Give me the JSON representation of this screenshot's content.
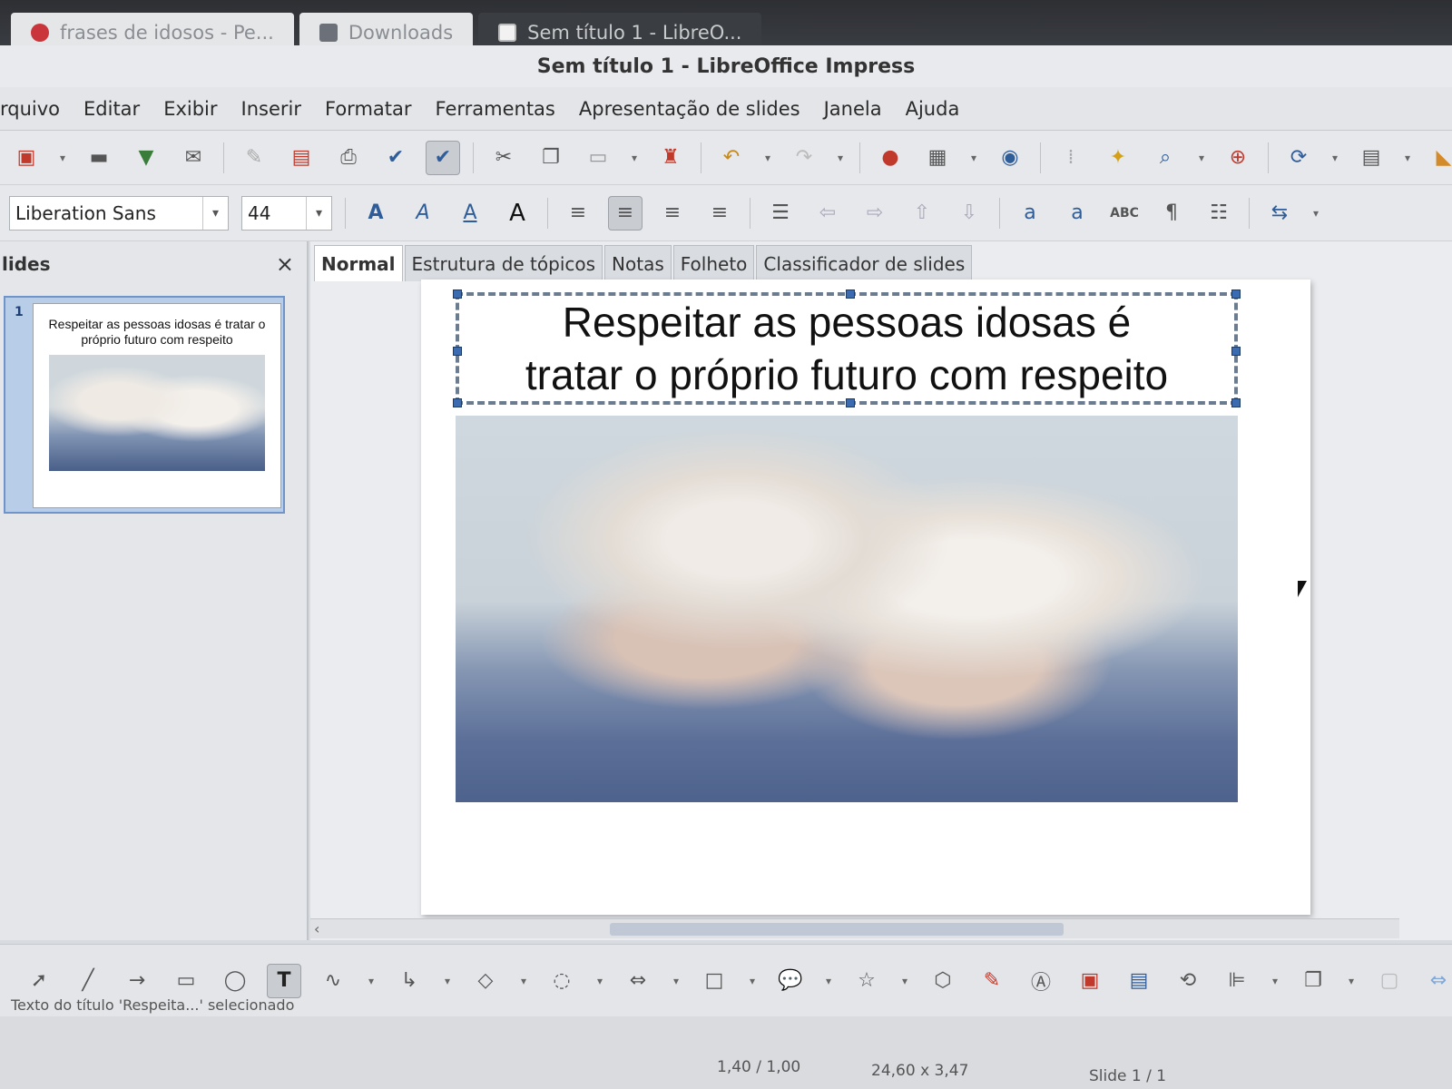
{
  "taskbar": {
    "tabs": [
      {
        "label": "frases de idosos - Pe...",
        "icon": "browser-icon"
      },
      {
        "label": "Downloads",
        "icon": "folder-icon"
      },
      {
        "label": "Sem título 1 - LibreO...",
        "icon": "document-icon"
      }
    ]
  },
  "window": {
    "title": "Sem título 1 - LibreOffice Impress"
  },
  "menu": {
    "items": [
      "rquivo",
      "Editar",
      "Exibir",
      "Inserir",
      "Formatar",
      "Ferramentas",
      "Apresentação de slides",
      "Janela",
      "Ajuda"
    ]
  },
  "format": {
    "font": "Liberation Sans",
    "size": "44"
  },
  "slides_panel": {
    "header": "lides",
    "close": "×",
    "thumb_number": "1",
    "thumb_title": "Respeitar as pessoas idosas é tratar o próprio futuro com respeito"
  },
  "views": {
    "tabs": [
      "Normal",
      "Estrutura de tópicos",
      "Notas",
      "Folheto",
      "Classificador de slides"
    ],
    "active": "Normal"
  },
  "slide": {
    "title_line1": "Respeitar as pessoas idosas é",
    "title_line2": "tratar o próprio futuro com respeito"
  },
  "status": {
    "message": "Texto do título 'Respeita...' selecionado",
    "position": "1,40 / 1,00",
    "size": "24,60 x 3,47",
    "slide": "Slide 1 / 1"
  },
  "colors": {
    "selection": "#6f94c9",
    "accent": "#3b6bb0"
  }
}
